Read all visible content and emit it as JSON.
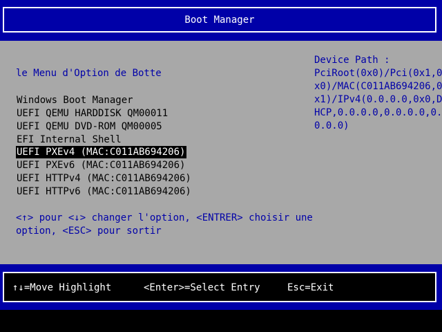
{
  "header": {
    "title": "Boot Manager"
  },
  "menu": {
    "title": "le Menu d'Option de Botte",
    "items": [
      {
        "label": "Windows Boot Manager",
        "selected": false
      },
      {
        "label": "UEFI QEMU HARDDISK QM00011",
        "selected": false
      },
      {
        "label": "UEFI QEMU DVD-ROM QM00005",
        "selected": false
      },
      {
        "label": "EFI Internal Shell",
        "selected": false
      },
      {
        "label": "UEFI PXEv4 (MAC:C011AB694206)",
        "selected": true
      },
      {
        "label": "UEFI PXEv6 (MAC:C011AB694206)",
        "selected": false
      },
      {
        "label": "UEFI HTTPv4 (MAC:C011AB694206)",
        "selected": false
      },
      {
        "label": "UEFI HTTPv6 (MAC:C011AB694206)",
        "selected": false
      }
    ]
  },
  "help": {
    "line1": "<↑> pour <↓> changer l'option, <ENTRER> choisir une",
    "line2": "option, <ESC> pour sortir"
  },
  "device_path": {
    "label": "Device Path :",
    "lines": [
      "PciRoot(0x0)/Pci(0x1,0",
      "x0)/MAC(C011AB694206,0",
      "x1)/IPv4(0.0.0.0,0x0,D",
      "HCP,0.0.0.0,0.0.0.0,0.",
      "0.0.0)"
    ]
  },
  "footer": {
    "move_hint": "↑↓=Move Highlight",
    "select_hint": "<Enter>=Select Entry",
    "exit_hint": "Esc=Exit"
  },
  "colors": {
    "blue": "#0000a8",
    "gray": "#a8a8a8",
    "black": "#000000",
    "white": "#ffffff"
  }
}
